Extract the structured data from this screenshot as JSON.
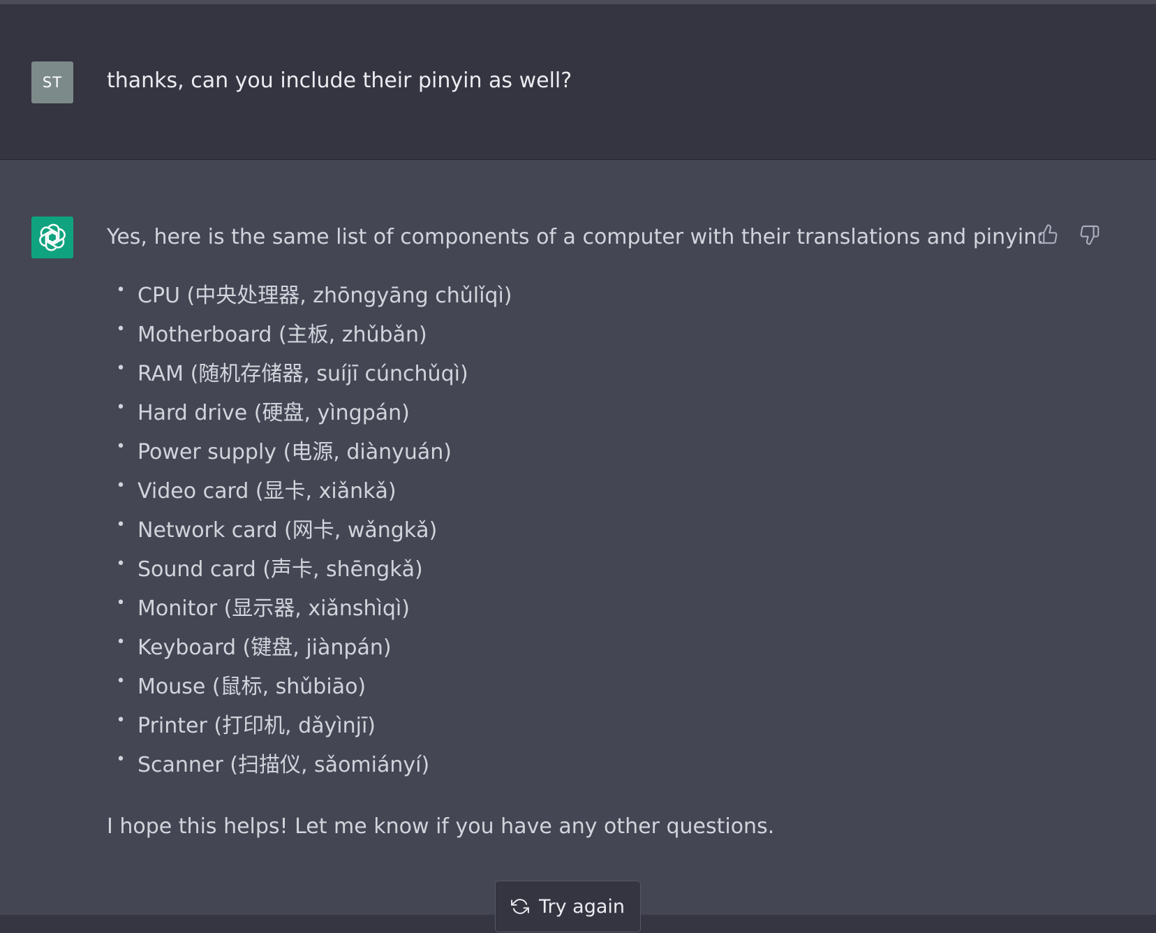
{
  "user_message": {
    "avatar_initials": "ST",
    "text": "thanks, can you include their pinyin as well?"
  },
  "assistant_message": {
    "avatar_icon": "openai-logo-icon",
    "intro": "Yes, here is the same list of components of a computer with their translations and pinyin:",
    "items": [
      "CPU (中央处理器, zhōngyāng chǔlǐqì)",
      "Motherboard (主板, zhǔbǎn)",
      "RAM (随机存储器, suíjī cúnchǔqì)",
      "Hard drive (硬盘, yìngpán)",
      "Power supply (电源, diànyuán)",
      "Video card (显卡, xiǎnkǎ)",
      "Network card (网卡, wǎngkǎ)",
      "Sound card (声卡, shēngkǎ)",
      "Monitor (显示器, xiǎnshìqì)",
      "Keyboard (键盘, jiànpán)",
      "Mouse (鼠标, shǔbiāo)",
      "Printer (打印机, dǎyìnjī)",
      "Scanner (扫描仪, sǎomiányí)"
    ],
    "outro": "I hope this helps! Let me know if you have any other questions.",
    "feedback": {
      "like_icon": "thumbs-up-icon",
      "dislike_icon": "thumbs-down-icon"
    }
  },
  "try_again": {
    "label": "Try again",
    "icon": "refresh-icon"
  },
  "colors": {
    "user_bg": "#343541",
    "assistant_bg": "#444654",
    "bot_avatar": "#10a37f",
    "user_avatar": "#7d8a8a",
    "text": "#d1d5db"
  }
}
